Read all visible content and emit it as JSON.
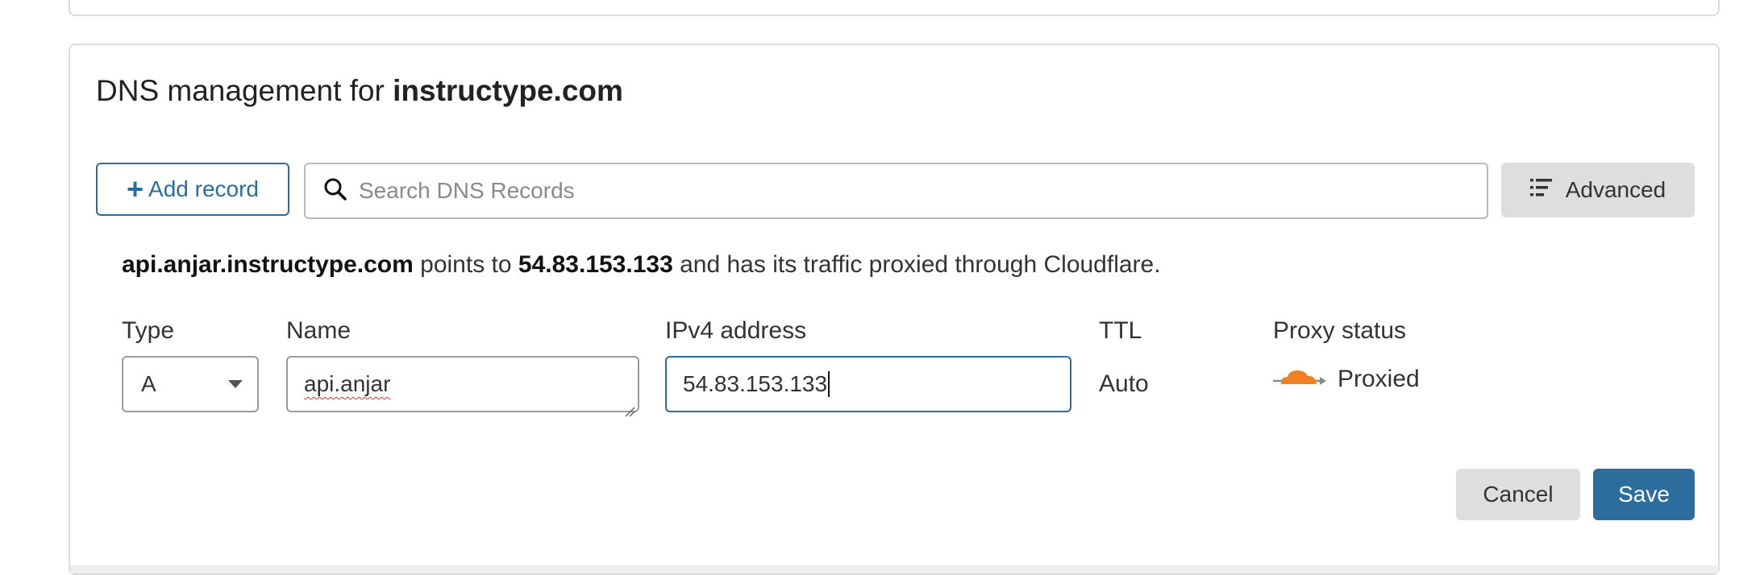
{
  "page": {
    "title_prefix": "DNS management for",
    "title_domain": "instructype.com"
  },
  "toolbar": {
    "add_record_label": "Add record",
    "search_placeholder": "Search DNS Records",
    "advanced_label": "Advanced"
  },
  "summary": {
    "record_name": "api.anjar.instructype.com",
    "points_to_text": "points to",
    "ip": "54.83.153.133",
    "suffix_text": "and has its traffic proxied through Cloudflare."
  },
  "form": {
    "type_label": "Type",
    "type_value": "A",
    "name_label": "Name",
    "name_value": "api.anjar",
    "ip_label": "IPv4 address",
    "ip_value": "54.83.153.133",
    "ttl_label": "TTL",
    "ttl_value": "Auto",
    "proxy_label": "Proxy status",
    "proxy_value": "Proxied",
    "proxy_icon": "cloudflare-cloud-icon",
    "accent_color": "#2c6d9e",
    "proxy_color": "#f38020"
  },
  "actions": {
    "cancel_label": "Cancel",
    "save_label": "Save"
  }
}
